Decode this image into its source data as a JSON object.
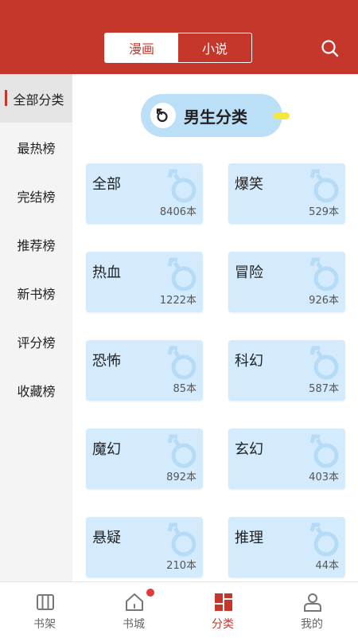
{
  "header": {
    "tabs": [
      {
        "label": "漫画",
        "active": true
      },
      {
        "label": "小说",
        "active": false
      }
    ],
    "search_icon": "search-icon"
  },
  "sidebar": {
    "items": [
      {
        "label": "全部分类",
        "active": true
      },
      {
        "label": "最热榜",
        "active": false
      },
      {
        "label": "完结榜",
        "active": false
      },
      {
        "label": "推荐榜",
        "active": false
      },
      {
        "label": "新书榜",
        "active": false
      },
      {
        "label": "评分榜",
        "active": false
      },
      {
        "label": "收藏榜",
        "active": false
      }
    ]
  },
  "main": {
    "gender_pill": {
      "label": "男生分类",
      "icon": "male-symbol-icon"
    },
    "categories": [
      {
        "name": "全部",
        "count": "8406本"
      },
      {
        "name": "爆笑",
        "count": "529本"
      },
      {
        "name": "热血",
        "count": "1222本"
      },
      {
        "name": "冒险",
        "count": "926本"
      },
      {
        "name": "恐怖",
        "count": "85本"
      },
      {
        "name": "科幻",
        "count": "587本"
      },
      {
        "name": "魔幻",
        "count": "892本"
      },
      {
        "name": "玄幻",
        "count": "403本"
      },
      {
        "name": "悬疑",
        "count": "210本"
      },
      {
        "name": "推理",
        "count": "44本"
      }
    ]
  },
  "bottom_nav": {
    "items": [
      {
        "label": "书架",
        "icon": "bookshelf-icon",
        "active": false
      },
      {
        "label": "书城",
        "icon": "home-icon",
        "active": false,
        "badge": true
      },
      {
        "label": "分类",
        "icon": "category-grid-icon",
        "active": true
      },
      {
        "label": "我的",
        "icon": "profile-icon",
        "active": false
      }
    ]
  },
  "colors": {
    "brand": "#c5372b",
    "card": "#d3ebfc",
    "pill": "#bcdff8"
  }
}
